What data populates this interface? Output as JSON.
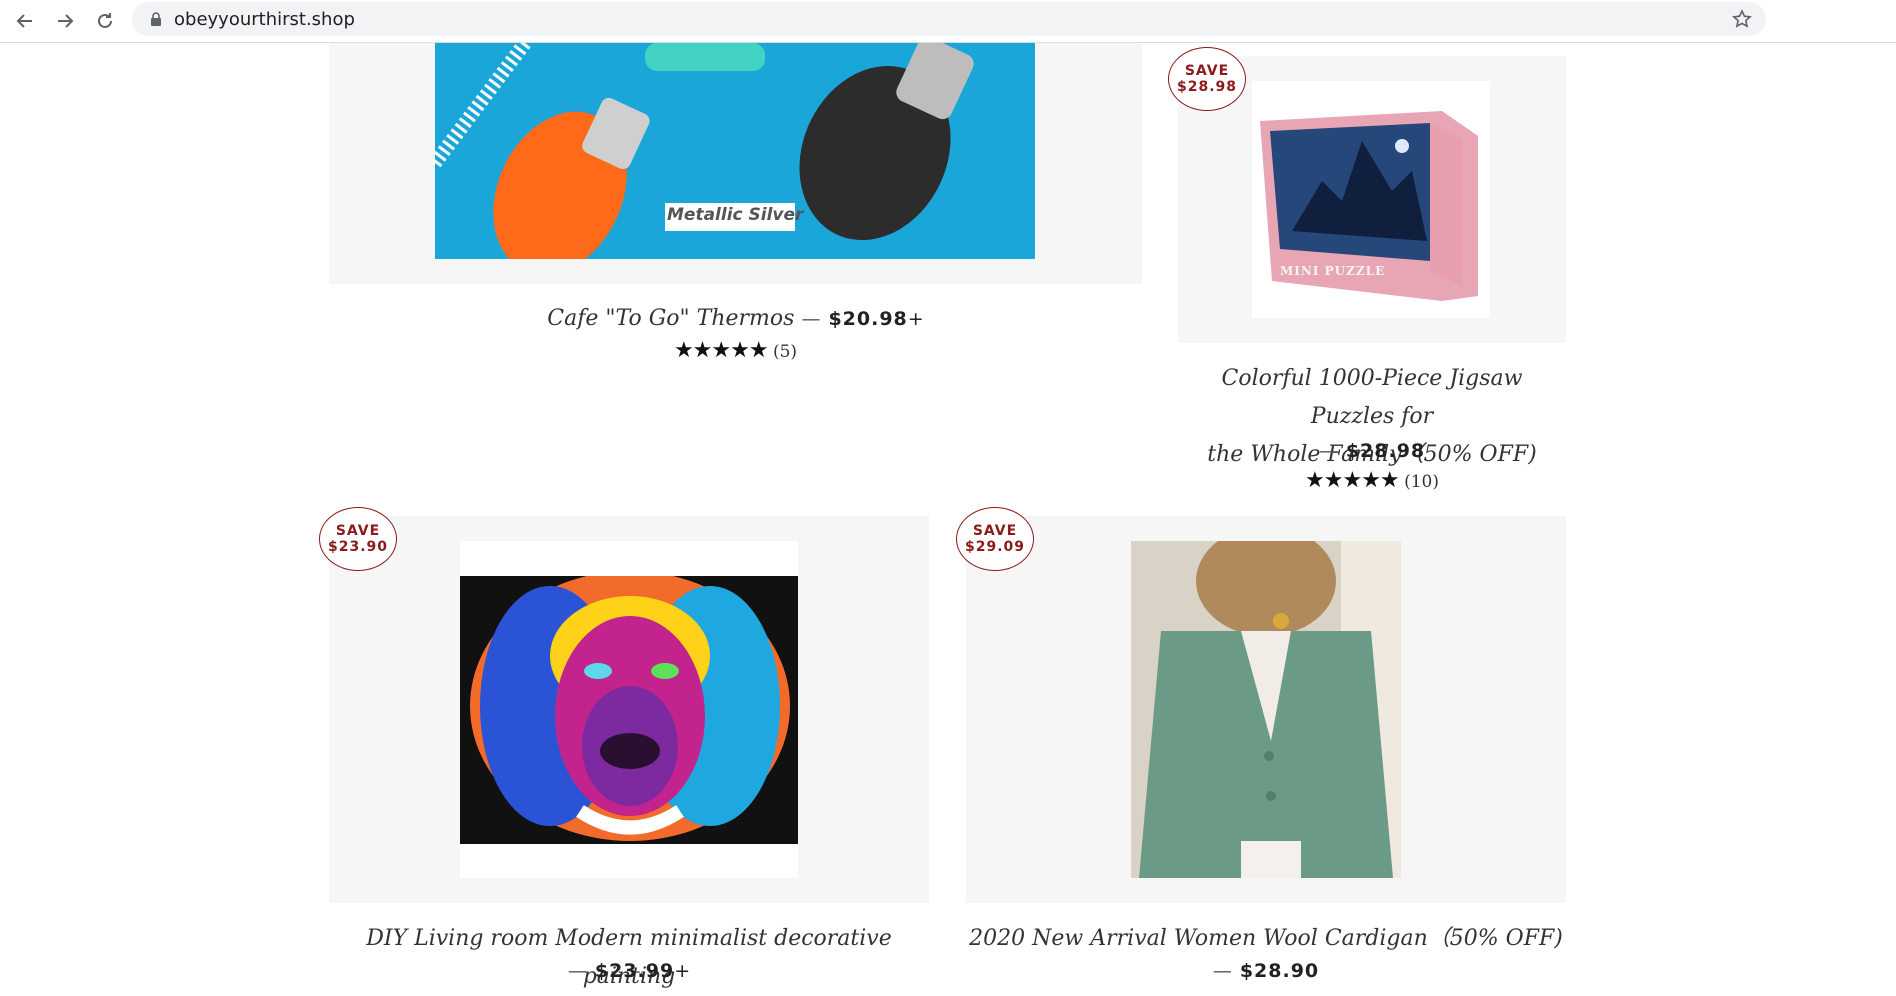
{
  "browser": {
    "url": "obeyyourthirst.shop"
  },
  "products": [
    {
      "title": "Cafe \"To Go\" Thermos",
      "dash": "—",
      "price": "$20.98",
      "plus": "+",
      "stars": "★★★★★",
      "reviews": "(5)",
      "image_text": "Metallic Silver"
    },
    {
      "badge_save": "SAVE",
      "badge_amount": "$28.98",
      "title_line1": "Colorful 1000-Piece Jigsaw Puzzles for",
      "title_line2": "the Whole Family（50% OFF)",
      "dash": "—",
      "price": "$28.98",
      "stars": "★★★★★",
      "reviews": "(10)",
      "image_text": "MINI PUZZLE"
    },
    {
      "badge_save": "SAVE",
      "badge_amount": "$23.90",
      "title": "DIY Living room Modern minimalist decorative painting",
      "dash": "—",
      "price": "$23.99",
      "plus": "+"
    },
    {
      "badge_save": "SAVE",
      "badge_amount": "$29.09",
      "title": "2020 New Arrival Women Wool Cardigan（50% OFF)",
      "dash": "—",
      "price": "$28.90"
    }
  ],
  "colors": {
    "badge": "#8b1a1a",
    "card_bg": "#f6f6f6",
    "thermos_bg": "#1aa6d8"
  }
}
